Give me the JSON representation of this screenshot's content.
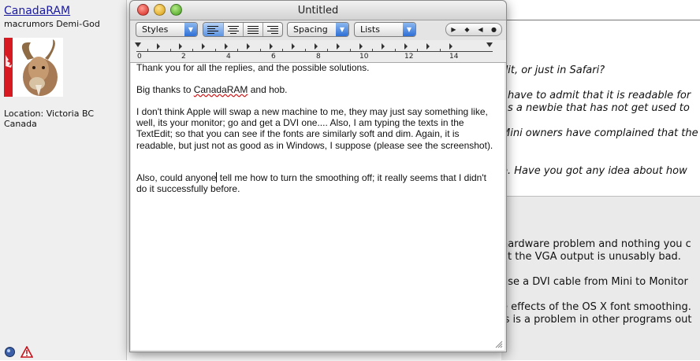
{
  "profile": {
    "username": "CanadaRAM",
    "title": "macrumors Demi-God",
    "location": "Location: Victoria BC Canada"
  },
  "background_post": {
    "lines": [
      "dit, or just in Safari?",
      "I have to admit that it is readable for",
      "as a newbie that has not get used to",
      "Mini owners have complained that the",
      "e. Have you got any idea about how",
      "hardware problem and nothing you c",
      "at the VGA output is unusably bad.",
      "use a DVI cable from Mini to Monitor",
      "e effects of the OS X font smoothing.",
      "is is a problem in other programs out"
    ]
  },
  "window": {
    "title": "Untitled",
    "toolbar": {
      "styles_label": "Styles",
      "spacing_label": "Spacing",
      "lists_label": "Lists"
    },
    "ruler": {
      "labels": [
        "0",
        "2",
        "4",
        "6",
        "8",
        "10",
        "12",
        "14"
      ]
    },
    "document": {
      "para1": "Thank you for all the replies, and the possible solutions.",
      "para2_pre": "Big thanks to ",
      "para2_link": "CanadaRAM",
      "para2_post": " and hob.",
      "para3": "I don't think Apple will swap a new machine to me, they may just say something like, well, its your monitor; go and get a DVI one.... Also, I am typing the texts in the TextEdit; so that you can see if the fonts are similarly soft and dim. Again, it is readable, but just not as good as in Windows, I suppose (please see the screenshot).",
      "para4_pre": "Also, could anyone",
      "para4_post": " tell me how to turn the smoothing off; it really seems that I didn't do it successfully before."
    }
  },
  "colors": {
    "link": "#1a1aa0",
    "accent_blue": "#2e6fd6",
    "spell_underline": "#d21c1c"
  }
}
